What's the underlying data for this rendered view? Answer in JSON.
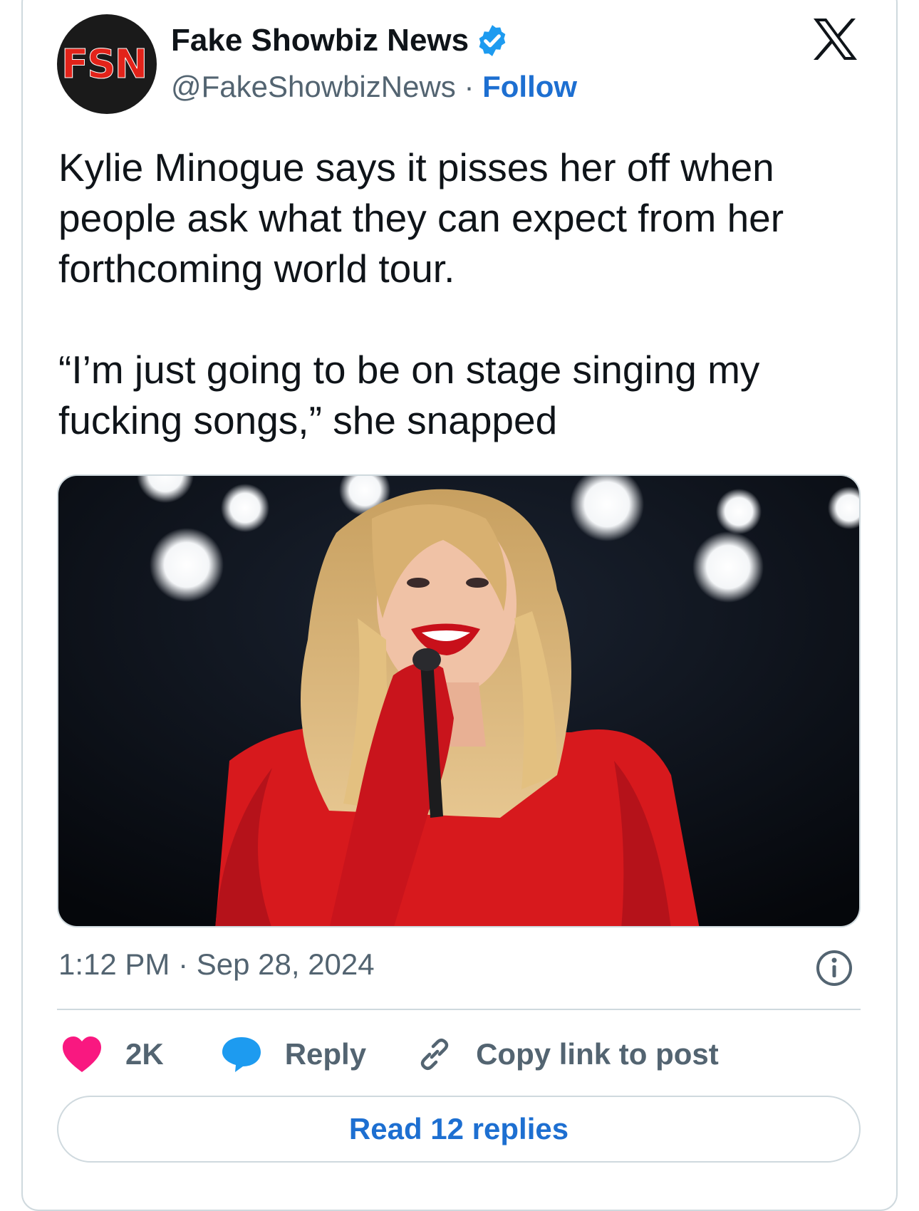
{
  "account": {
    "avatar_text": "FSN",
    "display_name": "Fake Showbiz News",
    "handle": "@FakeShowbizNews",
    "separator": " · ",
    "follow_label": "Follow",
    "verified": true
  },
  "tweet": {
    "paragraphs": [
      "Kylie Minogue says it pisses her off when people ask what they can expect from her forthcoming world tour.",
      "“I’m just going to be on stage singing my fucking songs,” she snapped"
    ],
    "timestamp": "1:12 PM · Sep 28, 2024"
  },
  "actions": {
    "like_count": "2K",
    "reply_label": "Reply",
    "copy_link_label": "Copy link to post"
  },
  "footer": {
    "read_replies_label": "Read 12 replies"
  },
  "colors": {
    "accent": "#1d6fd1",
    "like": "#f91880",
    "reply_bubble": "#1d9bf0",
    "border": "#cfd9de",
    "secondary_text": "#536471"
  },
  "icons": [
    "verified-badge-icon",
    "x-logo-icon",
    "info-icon",
    "heart-icon",
    "speech-bubble-icon",
    "link-icon"
  ]
}
